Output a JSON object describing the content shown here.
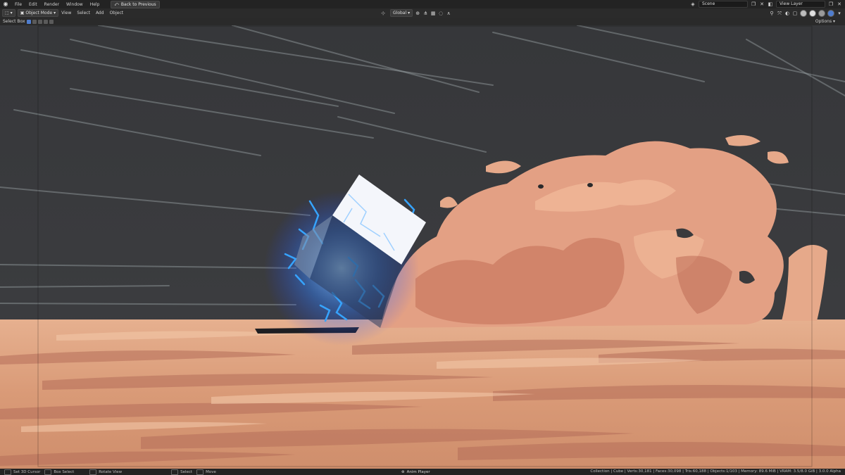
{
  "topbar": {
    "menus": [
      "File",
      "Edit",
      "Render",
      "Window",
      "Help"
    ],
    "back_button": "Back to Previous",
    "scene": "Scene",
    "view_layer": "View Layer"
  },
  "header": {
    "mode": "Object Mode",
    "menus": [
      "View",
      "Select",
      "Add",
      "Object"
    ],
    "transform_orientation": "Global"
  },
  "toolheader": {
    "tool": "Select Box",
    "options": "Options"
  },
  "statusbar": {
    "items": [
      "Set 3D Cursor",
      "Box Select",
      "Rotate View",
      "Select",
      "Move"
    ],
    "center": "Anim Player",
    "stats": "Collection | Cube | Verts:30,181 | Faces:30,098 | Tris:60,188 | Objects:1/103 | Memory: 89.6 MiB | VRAM: 3.5/8.0 GiB | 3.0.0 Alpha"
  },
  "colors": {
    "ui_bg": "#232323",
    "header_bg": "#2b2b2b",
    "viewport_bg": "#3a3a3c",
    "sand": "#e0a07c",
    "dust": "#e8a98a",
    "electric": "#3aa0ff"
  }
}
